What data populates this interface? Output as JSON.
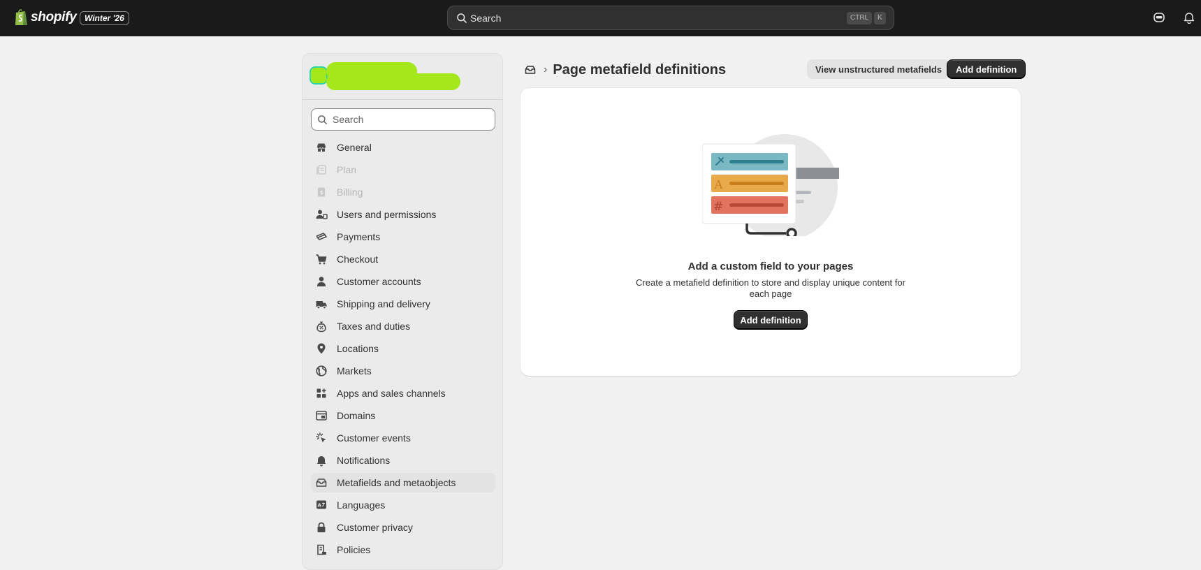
{
  "topbar": {
    "logo_text": "shopify",
    "edition": "Winter '26",
    "search_text": "Search",
    "shortcut_ctrl": "CTRL",
    "shortcut_key": "K"
  },
  "sidebar": {
    "search_placeholder": "Search",
    "items": [
      {
        "label": "General",
        "icon": "store-icon",
        "disabled": false,
        "active": false
      },
      {
        "label": "Plan",
        "icon": "plan-icon",
        "disabled": true,
        "active": false
      },
      {
        "label": "Billing",
        "icon": "billing-icon",
        "disabled": true,
        "active": false
      },
      {
        "label": "Users and permissions",
        "icon": "users-icon",
        "disabled": false,
        "active": false
      },
      {
        "label": "Payments",
        "icon": "payments-icon",
        "disabled": false,
        "active": false
      },
      {
        "label": "Checkout",
        "icon": "cart-icon",
        "disabled": false,
        "active": false
      },
      {
        "label": "Customer accounts",
        "icon": "person-icon",
        "disabled": false,
        "active": false
      },
      {
        "label": "Shipping and delivery",
        "icon": "truck-icon",
        "disabled": false,
        "active": false
      },
      {
        "label": "Taxes and duties",
        "icon": "tax-bag-icon",
        "disabled": false,
        "active": false
      },
      {
        "label": "Locations",
        "icon": "location-pin-icon",
        "disabled": false,
        "active": false
      },
      {
        "label": "Markets",
        "icon": "globe-icon",
        "disabled": false,
        "active": false
      },
      {
        "label": "Apps and sales channels",
        "icon": "apps-icon",
        "disabled": false,
        "active": false
      },
      {
        "label": "Domains",
        "icon": "domain-icon",
        "disabled": false,
        "active": false
      },
      {
        "label": "Customer events",
        "icon": "cursor-click-icon",
        "disabled": false,
        "active": false
      },
      {
        "label": "Notifications",
        "icon": "bell-icon",
        "disabled": false,
        "active": false
      },
      {
        "label": "Metafields and metaobjects",
        "icon": "metafields-icon",
        "disabled": false,
        "active": true
      },
      {
        "label": "Languages",
        "icon": "language-icon",
        "disabled": false,
        "active": false
      },
      {
        "label": "Customer privacy",
        "icon": "lock-icon",
        "disabled": false,
        "active": false
      },
      {
        "label": "Policies",
        "icon": "policy-icon",
        "disabled": false,
        "active": false
      }
    ]
  },
  "main": {
    "title": "Page metafield definitions",
    "breadcrumb_sep": "›",
    "view_unstructured_label": "View unstructured metafields",
    "add_definition_label": "Add definition",
    "empty": {
      "title": "Add a custom field to your pages",
      "description": "Create a metafield definition to store and display unique content for each page",
      "button_label": "Add definition"
    }
  },
  "colors": {
    "topbar_bg": "#1a1a1a",
    "primary_button": "#303030",
    "redaction": "#a4e81b",
    "illus_teal": "#7ab8c4",
    "illus_orange": "#e8a94b",
    "illus_red": "#e2735f"
  }
}
